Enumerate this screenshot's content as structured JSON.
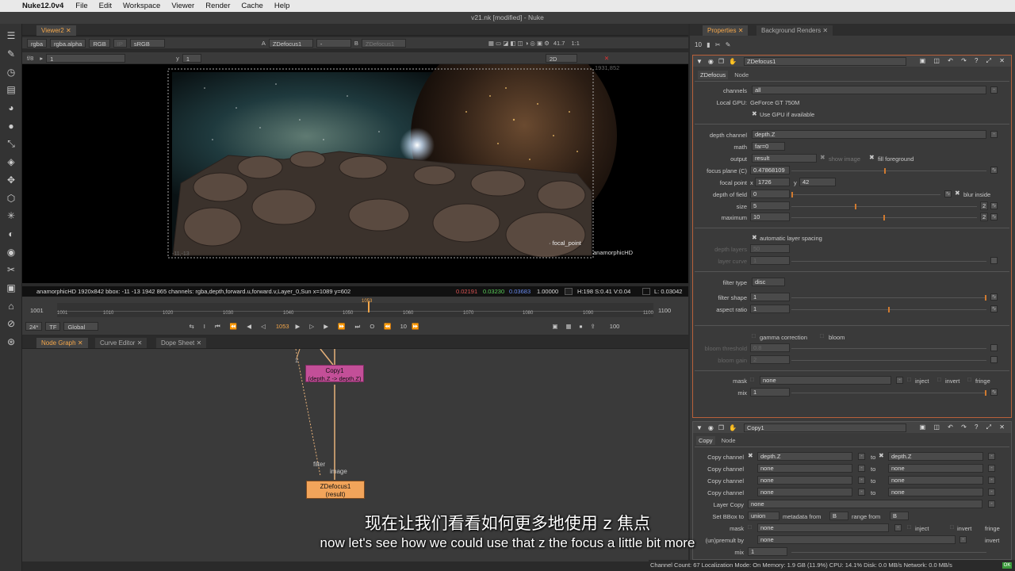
{
  "menubar": {
    "app": "Nuke12.0v4",
    "items": [
      "File",
      "Edit",
      "Workspace",
      "Viewer",
      "Render",
      "Cache",
      "Help"
    ]
  },
  "window_title": "v21.nk [modified] - Nuke",
  "viewer": {
    "tab_label": "Viewer2",
    "channels": "rgba",
    "alpha": "rgba.alpha",
    "display": "RGB",
    "ip": "IP",
    "colorspace": "sRGB",
    "input_a_label": "A",
    "input_a": "ZDefocus1",
    "input_a_op": "-",
    "input_b_label": "B",
    "input_b": "ZDefocus1",
    "zoom": "41.7",
    "ratio": "1:1",
    "fstop": "f/8",
    "frame": "1",
    "y_label": "y",
    "y_value": "1",
    "mode": "2D",
    "bbox_topright": "1931,852",
    "bbox_bottomleft": "-11,-13",
    "format_label": "anamorphicHD",
    "focal_point_label": "focal_point",
    "status_info": "anamorphicHD 1920x842  bbox: -11 -13 1942 865 channels: rgba,depth,forward.u,forward.v,Layer_0,Sun  x=1089 y=602",
    "pixel_r": "0.02191",
    "pixel_g": "0.03230",
    "pixel_b": "0.03683",
    "pixel_a": "1.00000",
    "hsv": "H:198 S:0.41 V:0.04",
    "luma": "L: 0.03042"
  },
  "timeline": {
    "start": "1001",
    "end": "1100",
    "current": "1053",
    "ticks": [
      "1001",
      "1010",
      "1020",
      "1030",
      "1040",
      "1050",
      "1060",
      "1070",
      "1080",
      "1090",
      "1100"
    ],
    "fps": "24*",
    "tf": "TF",
    "scope": "Global",
    "step": "10",
    "end_field": "100"
  },
  "node_tabs": [
    "Node Graph",
    "Curve Editor",
    "Dope Sheet"
  ],
  "nodes": {
    "copy_name": "Copy1",
    "copy_sub": "(depth.Z -> depth.Z)",
    "zdefocus_name": "ZDefocus1",
    "zdefocus_sub": "(result)",
    "filter_label": "filter",
    "image_label": "image",
    "input_one": "1"
  },
  "properties": {
    "tabs": [
      "Properties",
      "Background Renders"
    ],
    "max_panels": "10",
    "zdefocus": {
      "title": "ZDefocus1",
      "tabs": [
        "ZDefocus",
        "Node"
      ],
      "channels_label": "channels",
      "channels": "all",
      "gpu_label": "Local GPU:",
      "gpu": "GeForce GT 750M",
      "use_gpu": "Use GPU if available",
      "depth_channel_label": "depth channel",
      "depth_channel": "depth.Z",
      "math_label": "math",
      "math": "far=0",
      "output_label": "output",
      "output": "result",
      "show_image": "show image",
      "fill_foreground": "fill foreground",
      "focus_plane_label": "focus plane (C)",
      "focus_plane": "0.47868109",
      "focal_point_label": "focal point",
      "focal_x_label": "x",
      "focal_x": "1726",
      "focal_y_label": "y",
      "focal_y": "42",
      "dof_label": "depth of field",
      "dof": "0",
      "blur_inside": "blur inside",
      "size_label": "size",
      "size": "5",
      "size_right": "2",
      "maximum_label": "maximum",
      "maximum": "10",
      "maximum_right": "2",
      "auto_layer": "automatic layer spacing",
      "depth_layers_label": "depth layers",
      "depth_layers": "50",
      "layer_curve_label": "layer curve",
      "layer_curve": "1",
      "filter_type_label": "filter type",
      "filter_type": "disc",
      "filter_shape_label": "filter shape",
      "filter_shape": "1",
      "aspect_ratio_label": "aspect ratio",
      "aspect_ratio": "1",
      "gamma_correction": "gamma correction",
      "bloom": "bloom",
      "bloom_threshold_label": "bloom threshold",
      "bloom_threshold": "0.8",
      "bloom_gain_label": "bloom gain",
      "bloom_gain": "2",
      "mask_label": "mask",
      "mask": "none",
      "inject": "inject",
      "invert": "invert",
      "fringe": "fringe",
      "mix_label": "mix",
      "mix": "1"
    },
    "copy": {
      "title": "Copy1",
      "tabs": [
        "Copy",
        "Node"
      ],
      "copy_channel_label": "Copy channel",
      "to_label": "to",
      "rows": [
        {
          "from": "depth.Z",
          "to": "depth.Z"
        },
        {
          "from": "none",
          "to": "none"
        },
        {
          "from": "none",
          "to": "none"
        },
        {
          "from": "none",
          "to": "none"
        }
      ],
      "layer_copy_label": "Layer Copy",
      "layer_copy": "none",
      "set_bbox_label": "Set BBox to",
      "set_bbox": "union",
      "metadata_label": "metadata from",
      "metadata": "B",
      "range_label": "range from",
      "range": "B",
      "mask_label": "mask",
      "mask": "none",
      "inject": "inject",
      "invert": "invert",
      "fringe": "fringe",
      "result_label": "(un)premult by",
      "result": "none",
      "invert2": "invert",
      "mix_label": "mix",
      "mix": "1"
    }
  },
  "bottom_status": "Channel Count: 67  Localization Mode: On  Memory: 1.9 GB (11.9%)  CPU: 14.1%  Disk: 0.0 MB/s  Network: 0.0 MB/s",
  "subtitle_cn": "现在让我们看看如何更多地使用 z 焦点",
  "subtitle_en": "now let's see how we could use that z the focus a little bit more"
}
